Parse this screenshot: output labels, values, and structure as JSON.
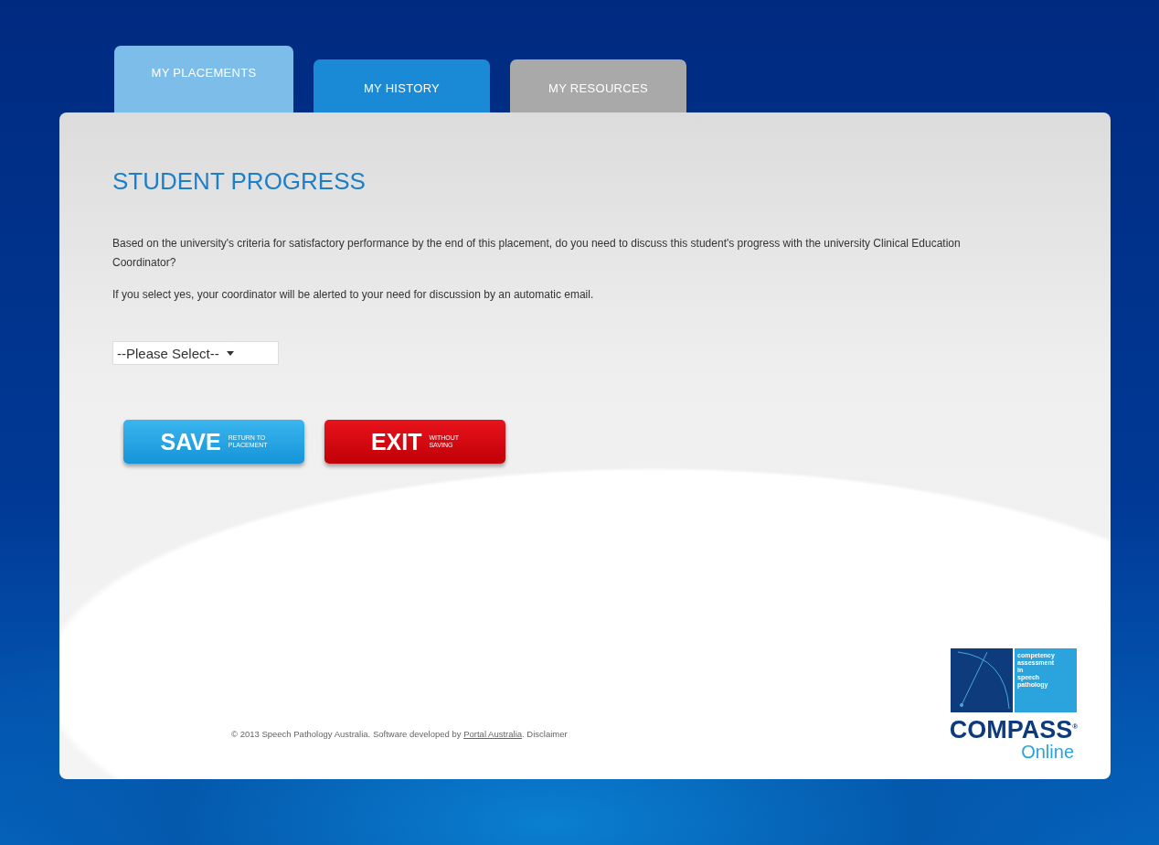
{
  "tabs": [
    {
      "label": "MY PLACEMENTS",
      "selected": true,
      "color": "#7dbde9"
    },
    {
      "label": "MY HISTORY",
      "selected": false,
      "color": "#1a8ad6"
    },
    {
      "label": "MY RESOURCES",
      "selected": false,
      "color": "#a9a9a9"
    }
  ],
  "heading": "STUDENT PROGRESS",
  "paragraphs": [
    "Based on the university's criteria for satisfactory performance by the end of this placement, do you need to discuss this student's progress with the university Clinical Education Coordinator?",
    "If you select yes, your coordinator will be alerted to your need for discussion by an automatic email."
  ],
  "select": {
    "value": "--Please Select--"
  },
  "buttons": [
    {
      "kind": "save",
      "label": "SAVE",
      "sublabel": [
        "RETURN TO",
        "PLACEMENT"
      ]
    },
    {
      "kind": "exit",
      "label": "EXIT",
      "sublabel": [
        "WITHOUT",
        "SAVING"
      ]
    }
  ],
  "footer": {
    "text": "© 2013 Speech Pathology Australia. Software developed by ",
    "link": "Portal Australia",
    "after": ".",
    "disclaimer": "Disclaimer"
  },
  "logo": {
    "tagline": [
      "competency",
      "assessment",
      "in",
      "speech",
      "pathology"
    ],
    "name": "COMPASS",
    "mark": "®",
    "sub": "Online"
  }
}
